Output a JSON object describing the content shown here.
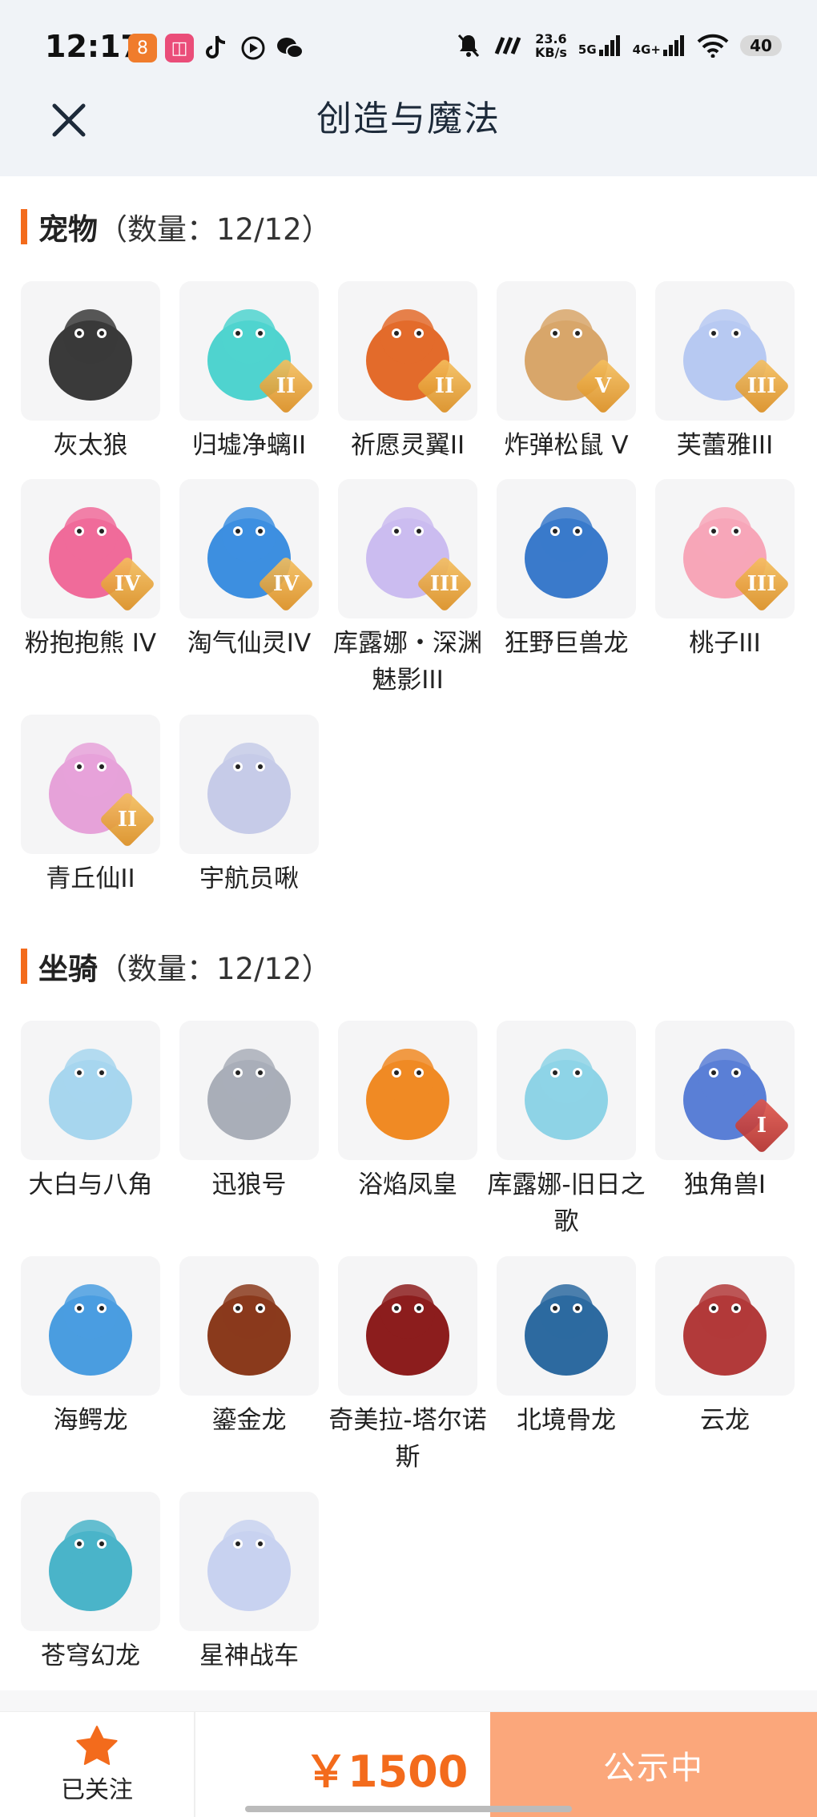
{
  "status_bar": {
    "time": "12:17",
    "net_speed": "23.6",
    "net_unit": "KB/s",
    "sig1_label": "5G",
    "sig2_label": "4G+",
    "battery": "40"
  },
  "header": {
    "title": "创造与魔法"
  },
  "pets": {
    "name": "宠物",
    "count": "（数量：12/12）",
    "items": [
      {
        "name": "灰太狼",
        "icon": "wolf-icon",
        "tier": "",
        "color": "#3a3a3a"
      },
      {
        "name": "归墟净螭II",
        "icon": "water-dragon-icon",
        "tier": "II",
        "color": "#4fd3cf"
      },
      {
        "name": "祈愿灵翼II",
        "icon": "eagle-icon",
        "tier": "II",
        "color": "#e36b2b"
      },
      {
        "name": "炸弹松鼠 V",
        "icon": "squirrel-icon",
        "tier": "V",
        "color": "#d8a66a"
      },
      {
        "name": "芙蕾雅III",
        "icon": "goddess-icon",
        "tier": "III",
        "color": "#b7c9f2"
      },
      {
        "name": "粉抱抱熊 IV",
        "icon": "pink-bear-icon",
        "tier": "IV",
        "color": "#f06b9a"
      },
      {
        "name": "淘气仙灵IV",
        "icon": "blue-dog-icon",
        "tier": "IV",
        "color": "#3d8fe0"
      },
      {
        "name": "库露娜・深渊魅影III",
        "icon": "phantom-icon",
        "tier": "III",
        "color": "#cbbcf0"
      },
      {
        "name": "狂野巨兽龙",
        "icon": "beast-dragon-icon",
        "tier": "",
        "color": "#3a7acb"
      },
      {
        "name": "桃子III",
        "icon": "peach-cat-icon",
        "tier": "III",
        "color": "#f7a6b8"
      },
      {
        "name": "青丘仙II",
        "icon": "fox-fairy-icon",
        "tier": "II",
        "color": "#e6a2d9"
      },
      {
        "name": "宇航员啾",
        "icon": "astronaut-icon",
        "tier": "",
        "color": "#c6cbe8"
      }
    ]
  },
  "mounts": {
    "name": "坐骑",
    "count": "（数量：12/12）",
    "items": [
      {
        "name": "大白与八角",
        "icon": "whale-icon",
        "tier": "",
        "color": "#a7d6ee"
      },
      {
        "name": "迅狼号",
        "icon": "mecha-wolf-icon",
        "tier": "",
        "color": "#a9aeb8"
      },
      {
        "name": "浴焰凤皇",
        "icon": "phoenix-icon",
        "tier": "",
        "color": "#f08a24"
      },
      {
        "name": "库露娜-旧日之歌",
        "icon": "sheep-girl-icon",
        "tier": "",
        "color": "#8ed3e6"
      },
      {
        "name": "独角兽I",
        "icon": "unicorn-icon",
        "tier": "I",
        "color": "#5a7fd6"
      },
      {
        "name": "海鳄龙",
        "icon": "sea-dragon-icon",
        "tier": "",
        "color": "#4a9de0"
      },
      {
        "name": "鎏金龙",
        "icon": "gold-dragon-icon",
        "tier": "",
        "color": "#8a3a1c"
      },
      {
        "name": "奇美拉-塔尔诺斯",
        "icon": "chimera-icon",
        "tier": "",
        "color": "#8c1d1d"
      },
      {
        "name": "北境骨龙",
        "icon": "bone-dragon-icon",
        "tier": "",
        "color": "#2d6aa0"
      },
      {
        "name": "云龙",
        "icon": "cloud-dragon-icon",
        "tier": "",
        "color": "#b23a3a"
      },
      {
        "name": "苍穹幻龙",
        "icon": "sky-dragon-icon",
        "tier": "",
        "color": "#4ab4c9"
      },
      {
        "name": "星神战车",
        "icon": "star-chariot-icon",
        "tier": "",
        "color": "#c8d2f0"
      }
    ]
  },
  "bottom_bar": {
    "follow_label": "已关注",
    "price": "￥1500",
    "status_button": "公示中"
  },
  "colors": {
    "accent": "#f36b1c",
    "button": "#fba77b"
  }
}
